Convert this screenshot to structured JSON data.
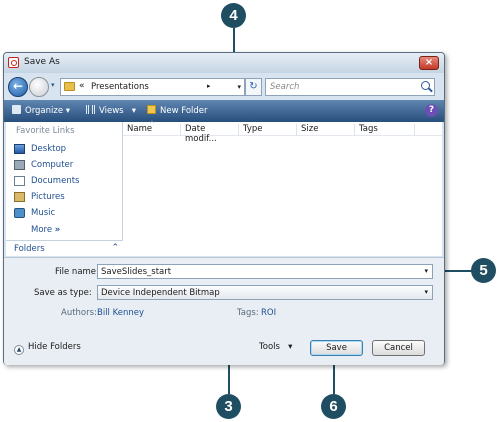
{
  "window": {
    "title": "Save As",
    "close_glyph": "×"
  },
  "address": {
    "sep": "«",
    "path": "Presentations",
    "crumb_arrow": "▸",
    "refresh_glyph": "↻",
    "search_placeholder": "Search"
  },
  "toolbar": {
    "organize": "Organize",
    "views": "Views",
    "new_folder": "New Folder",
    "dropdown_glyph": "▾",
    "help_glyph": "?"
  },
  "nav": {
    "heading": "Favorite Links",
    "items": [
      {
        "label": "Desktop",
        "icon": "desktop-icon"
      },
      {
        "label": "Computer",
        "icon": "computer-icon"
      },
      {
        "label": "Documents",
        "icon": "documents-icon"
      },
      {
        "label": "Pictures",
        "icon": "pictures-icon"
      },
      {
        "label": "Music",
        "icon": "music-icon"
      }
    ],
    "more": "More",
    "more_glyph": "»",
    "folders": "Folders",
    "folders_chevron": "⌃"
  },
  "filelist": {
    "columns": [
      "Name",
      "Date modif...",
      "Type",
      "Size",
      "Tags"
    ],
    "sort_glyph": "^"
  },
  "form": {
    "filename_label": "File name:",
    "filename_value": "SaveSlides_start",
    "savetype_label": "Save as type:",
    "savetype_value": "Device Independent Bitmap",
    "authors_label": "Authors:",
    "authors_value": "Bill Kenney",
    "tags_label": "Tags:",
    "tags_value": "ROI",
    "hide_folders": "Hide Folders",
    "hide_glyph": "▲",
    "tools": "Tools",
    "save": "Save",
    "cancel": "Cancel"
  },
  "callouts": [
    "4",
    "5",
    "3",
    "6"
  ],
  "colors": {
    "callout": "#1f4e63",
    "toolbar": "#3a6594",
    "link": "#1f4f8f"
  }
}
